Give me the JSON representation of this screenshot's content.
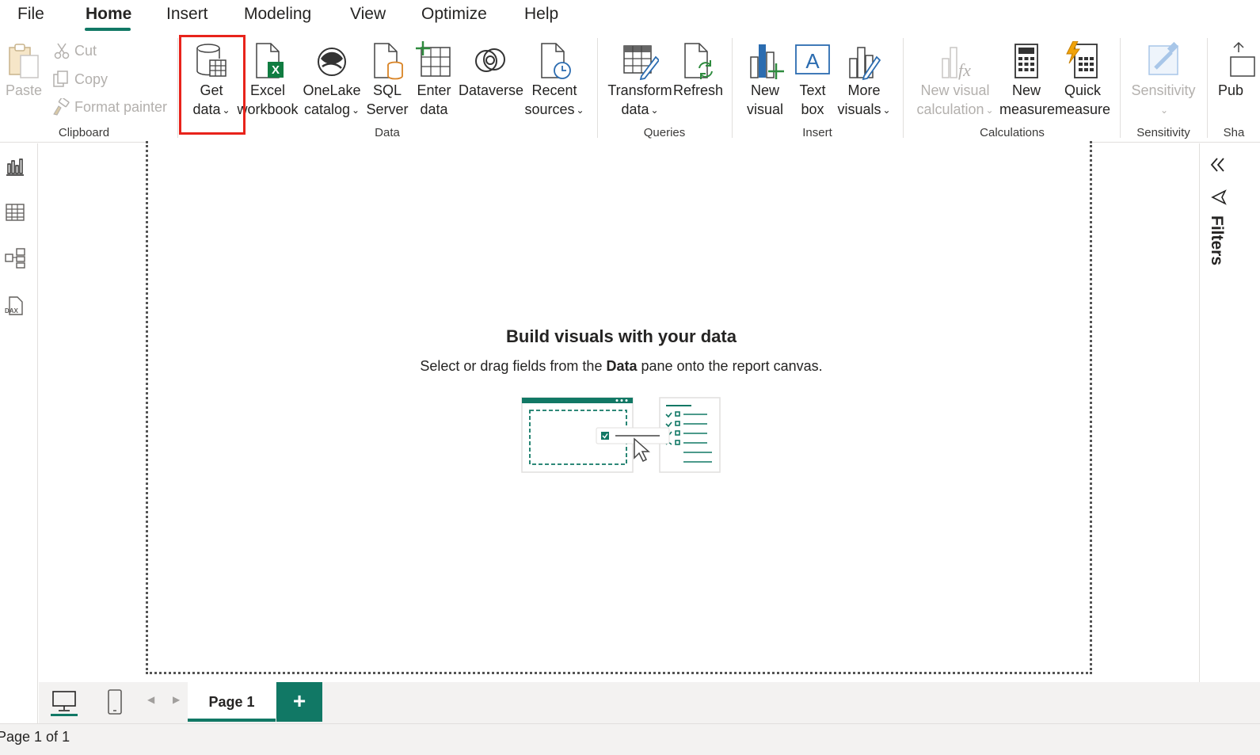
{
  "menu": {
    "items": [
      {
        "label": "File",
        "active": false
      },
      {
        "label": "Home",
        "active": true
      },
      {
        "label": "Insert",
        "active": false
      },
      {
        "label": "Modeling",
        "active": false
      },
      {
        "label": "View",
        "active": false
      },
      {
        "label": "Optimize",
        "active": false
      },
      {
        "label": "Help",
        "active": false
      }
    ]
  },
  "ribbon": {
    "clipboard": {
      "paste": "Paste",
      "cut": "Cut",
      "copy": "Copy",
      "format_painter": "Format painter",
      "group": "Clipboard"
    },
    "data": {
      "get_data": [
        "Get",
        "data"
      ],
      "excel": [
        "Excel",
        "workbook"
      ],
      "onelake": [
        "OneLake",
        "catalog"
      ],
      "sql": [
        "SQL",
        "Server"
      ],
      "enter": [
        "Enter",
        "data"
      ],
      "dataverse": "Dataverse",
      "recent": [
        "Recent",
        "sources"
      ],
      "group": "Data"
    },
    "queries": {
      "transform": [
        "Transform",
        "data"
      ],
      "refresh": "Refresh",
      "group": "Queries"
    },
    "insert": {
      "new_visual": [
        "New",
        "visual"
      ],
      "text_box": [
        "Text",
        "box"
      ],
      "more_visuals": [
        "More",
        "visuals"
      ],
      "group": "Insert"
    },
    "calculations": {
      "new_visual_calc": [
        "New visual",
        "calculation"
      ],
      "new_measure": [
        "New",
        "measure"
      ],
      "quick_measure": [
        "Quick",
        "measure"
      ],
      "group": "Calculations"
    },
    "sensitivity": {
      "label": "Sensitivity",
      "group": "Sensitivity"
    },
    "share": {
      "publish": "Pub",
      "group": "Sha"
    }
  },
  "canvas": {
    "title": "Build visuals with your data",
    "subtitle_before": "Select or drag fields from the ",
    "subtitle_bold": "Data",
    "subtitle_after": " pane onto the report canvas."
  },
  "filters": {
    "label": "Filters"
  },
  "pages": {
    "tab": "Page 1",
    "add": "+"
  },
  "status": {
    "text": "Page 1 of 1"
  },
  "colors": {
    "accent": "#117865",
    "highlight": "#e8231b",
    "disabled": "#b3b0ad"
  }
}
